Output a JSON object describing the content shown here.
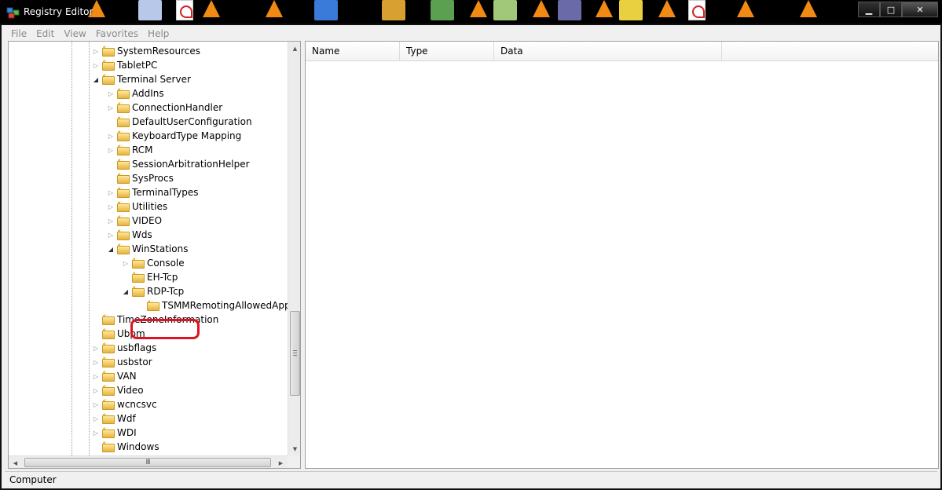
{
  "window": {
    "title": "Registry Editor",
    "minimize_glyph": "▁",
    "maximize_glyph": "□",
    "close_glyph": "✕"
  },
  "menu": [
    "File",
    "Edit",
    "View",
    "Favorites",
    "Help"
  ],
  "tree": [
    {
      "label": "SystemResources",
      "depth": 0,
      "expander": "collapsed"
    },
    {
      "label": "TabletPC",
      "depth": 0,
      "expander": "collapsed"
    },
    {
      "label": "Terminal Server",
      "depth": 0,
      "expander": "expanded"
    },
    {
      "label": "AddIns",
      "depth": 1,
      "expander": "collapsed"
    },
    {
      "label": "ConnectionHandler",
      "depth": 1,
      "expander": "collapsed"
    },
    {
      "label": "DefaultUserConfiguration",
      "depth": 1,
      "expander": "none"
    },
    {
      "label": "KeyboardType Mapping",
      "depth": 1,
      "expander": "collapsed"
    },
    {
      "label": "RCM",
      "depth": 1,
      "expander": "collapsed"
    },
    {
      "label": "SessionArbitrationHelper",
      "depth": 1,
      "expander": "none"
    },
    {
      "label": "SysProcs",
      "depth": 1,
      "expander": "none"
    },
    {
      "label": "TerminalTypes",
      "depth": 1,
      "expander": "collapsed"
    },
    {
      "label": "Utilities",
      "depth": 1,
      "expander": "collapsed"
    },
    {
      "label": "VIDEO",
      "depth": 1,
      "expander": "collapsed"
    },
    {
      "label": "Wds",
      "depth": 1,
      "expander": "collapsed"
    },
    {
      "label": "WinStations",
      "depth": 1,
      "expander": "expanded"
    },
    {
      "label": "Console",
      "depth": 2,
      "expander": "collapsed"
    },
    {
      "label": "EH-Tcp",
      "depth": 2,
      "expander": "none"
    },
    {
      "label": "RDP-Tcp",
      "depth": 2,
      "expander": "expanded",
      "highlighted": true
    },
    {
      "label": "TSMMRemotingAllowedApps",
      "depth": 3,
      "expander": "none"
    },
    {
      "label": "TimeZoneInformation",
      "depth": 0,
      "expander": "none"
    },
    {
      "label": "Ubpm",
      "depth": 0,
      "expander": "none"
    },
    {
      "label": "usbflags",
      "depth": 0,
      "expander": "collapsed"
    },
    {
      "label": "usbstor",
      "depth": 0,
      "expander": "collapsed"
    },
    {
      "label": "VAN",
      "depth": 0,
      "expander": "collapsed"
    },
    {
      "label": "Video",
      "depth": 0,
      "expander": "collapsed"
    },
    {
      "label": "wcncsvc",
      "depth": 0,
      "expander": "collapsed"
    },
    {
      "label": "Wdf",
      "depth": 0,
      "expander": "collapsed"
    },
    {
      "label": "WDI",
      "depth": 0,
      "expander": "collapsed"
    },
    {
      "label": "Windows",
      "depth": 0,
      "expander": "none"
    }
  ],
  "columns": {
    "name": "Name",
    "type": "Type",
    "data": "Data"
  },
  "scrollbar": {
    "up_glyph": "▲",
    "down_glyph": "▼",
    "left_glyph": "◀",
    "right_glyph": "▶",
    "h_grip": "III"
  },
  "statusbar": {
    "path": "Computer"
  },
  "colors": {
    "highlight": "#e0121f",
    "folder": "#e6b440"
  }
}
